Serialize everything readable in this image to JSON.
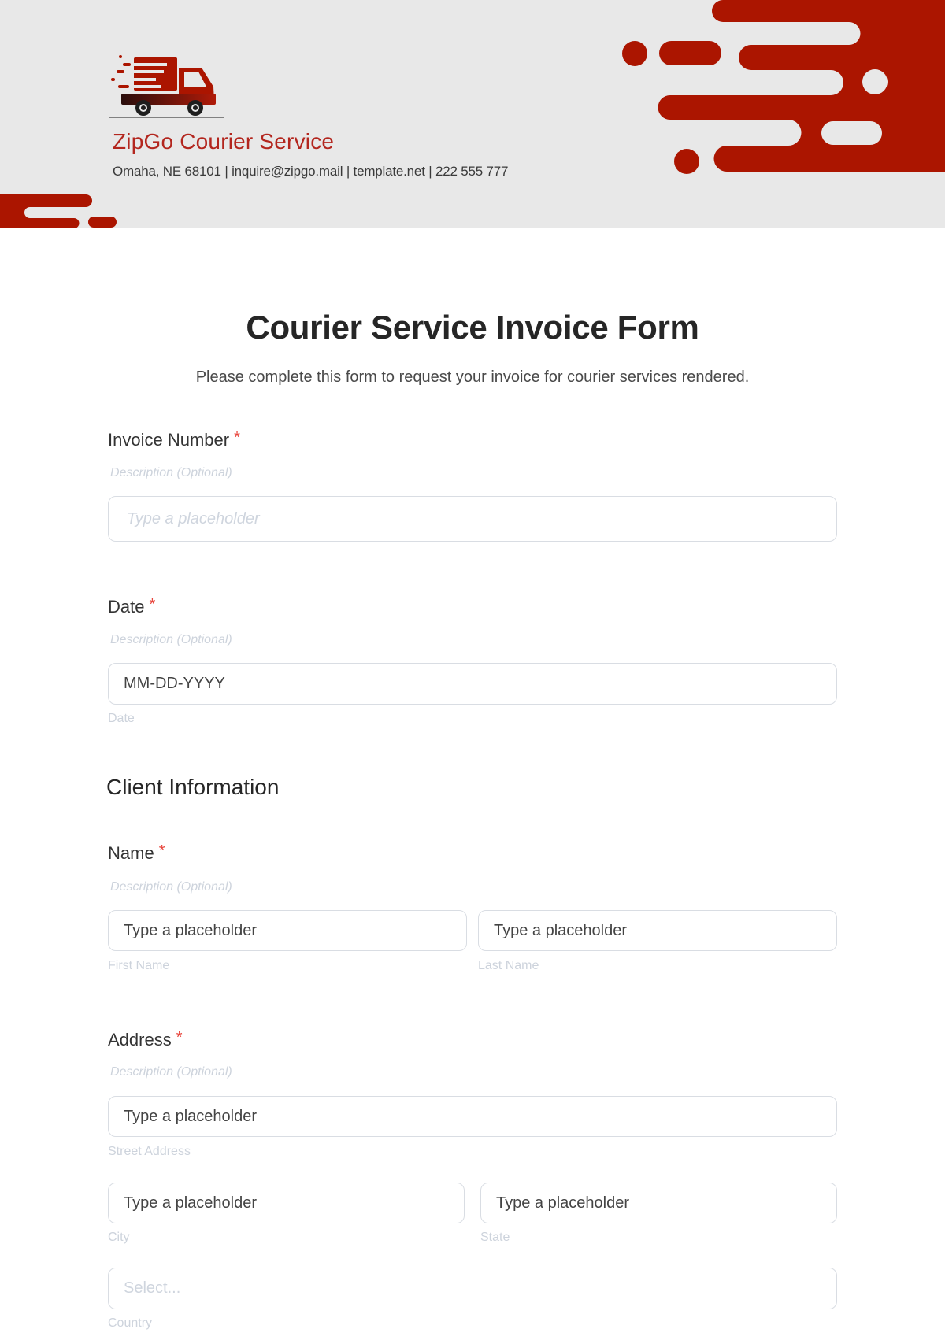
{
  "header": {
    "company_name": "ZipGo Courier Service",
    "contact_line": "Omaha, NE 68101 | inquire@zipgo.mail | template.net | 222 555 777",
    "logo_icon": "delivery-truck-icon",
    "brand_color": "#ab1500",
    "background_color": "#e8e8e8"
  },
  "form": {
    "title": "Courier Service Invoice Form",
    "subtitle": "Please complete this form to request your invoice for courier services rendered.",
    "required_marker": "*",
    "fields": {
      "invoice_number": {
        "label": "Invoice Number",
        "description": "Description (Optional)",
        "placeholder": "Type a placeholder"
      },
      "date": {
        "label": "Date",
        "description": "Description (Optional)",
        "placeholder": "MM-DD-YYYY",
        "sublabel": "Date"
      }
    },
    "sections": {
      "client_information": {
        "title": "Client Information",
        "name": {
          "label": "Name",
          "description": "Description (Optional)",
          "first_placeholder": "Type a placeholder",
          "first_sublabel": "First Name",
          "last_placeholder": "Type a placeholder",
          "last_sublabel": "Last Name"
        },
        "address": {
          "label": "Address",
          "description": "Description (Optional)",
          "street_placeholder": "Type a placeholder",
          "street_sublabel": "Street Address",
          "city_placeholder": "Type a placeholder",
          "city_sublabel": "City",
          "state_placeholder": "Type a placeholder",
          "state_sublabel": "State",
          "country_placeholder": "Select...",
          "country_sublabel": "Country"
        }
      }
    }
  }
}
